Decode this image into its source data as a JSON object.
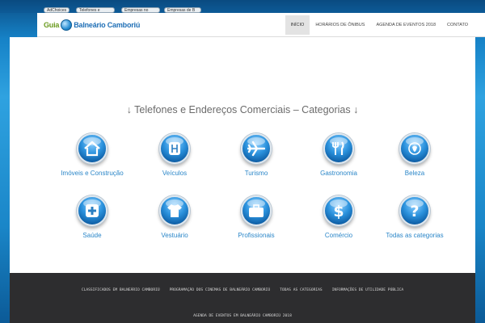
{
  "ads": {
    "adchoices": "AdChoices",
    "pills": [
      "Telefones e",
      "Empresas no",
      "Empresas de B"
    ]
  },
  "header": {
    "logo_word1": "Guia",
    "logo_word2": "Balneário Camboriú",
    "nav": [
      {
        "label": "INÍCIO",
        "active": true
      },
      {
        "label": "HORÁRIOS DE ÔNIBUS"
      },
      {
        "label": "AGENDA DE EVENTOS 2018"
      },
      {
        "label": "CONTATO"
      }
    ]
  },
  "main": {
    "section_title": "↓ Telefones e Endereços Comerciais – Categorias ↓",
    "categories": [
      {
        "label": "Imóveis e Construção",
        "icon": "house-icon"
      },
      {
        "label": "Veículos",
        "icon": "gear-shift-icon"
      },
      {
        "label": "Turismo",
        "icon": "airplane-icon"
      },
      {
        "label": "Gastronomia",
        "icon": "fork-knife-icon"
      },
      {
        "label": "Beleza",
        "icon": "beauty-icon"
      },
      {
        "label": "Saúde",
        "icon": "medical-cross-icon"
      },
      {
        "label": "Vestuário",
        "icon": "shirt-icon"
      },
      {
        "label": "Profissionais",
        "icon": "briefcase-icon"
      },
      {
        "label": "Comércio",
        "icon": "dollar-icon"
      },
      {
        "label": "Todas as categorias",
        "icon": "question-icon"
      }
    ]
  },
  "footer": {
    "links": [
      "CLASSIFICADOS EM BALNEÁRIO CAMBORIÚ",
      "PROGRAMAÇÃO DOS CINEMAS DE BALNEÁRIO CAMBORIÚ",
      "TODAS AS CATEGORIAS",
      "INFORMAÇÕES DE UTILIDADE PÚBLICA"
    ],
    "second_line": "AGENDA DE EVENTOS EM BALNEÁRIO CAMBORIÚ 2018"
  },
  "colors": {
    "accent": "#2a86c8",
    "footer_bg": "#2d2d2f",
    "page_bg": "#1a86c8"
  }
}
